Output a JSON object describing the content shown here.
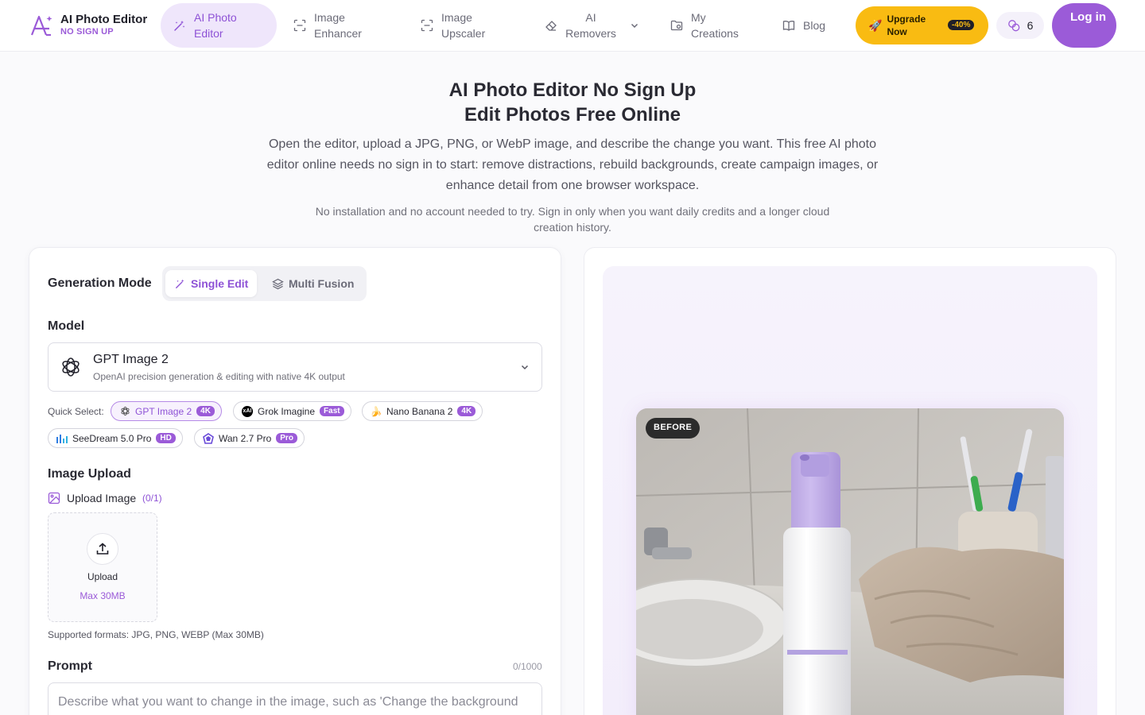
{
  "brand": {
    "name": "AI Photo Editor",
    "sub": "NO SIGN UP"
  },
  "nav": [
    {
      "label": "AI Photo Editor",
      "icon": "magic-wand-icon",
      "active": true
    },
    {
      "label": "Image Enhancer",
      "icon": "scan-icon"
    },
    {
      "label": "Image Upscaler",
      "icon": "scan-icon"
    },
    {
      "label": "AI Removers",
      "icon": "eraser-icon",
      "has_dropdown": true
    },
    {
      "label": "My Creations",
      "icon": "folder-icon"
    },
    {
      "label": "Blog",
      "icon": "book-icon"
    }
  ],
  "upgrade": {
    "label": "Upgrade Now",
    "discount": "-40%",
    "icon": "rocket-icon"
  },
  "credits": {
    "count": "6",
    "icon": "coins-icon"
  },
  "login": {
    "label": "Log in"
  },
  "hero": {
    "title_line1": "AI Photo Editor No Sign Up",
    "title_line2": "Edit Photos Free Online",
    "description": "Open the editor, upload a JPG, PNG, or WebP image, and describe the change you want. This free AI photo editor online needs no sign in to start: remove distractions, rebuild backgrounds, create campaign images, or enhance detail from one browser workspace.",
    "note": "No installation and no account needed to try. Sign in only when you want daily credits and a longer cloud creation history."
  },
  "generation": {
    "label": "Generation Mode",
    "modes": [
      {
        "label": "Single Edit",
        "selected": true
      },
      {
        "label": "Multi Fusion",
        "selected": false
      }
    ]
  },
  "model": {
    "label": "Model",
    "selected_name": "GPT Image 2",
    "selected_desc": "OpenAI precision generation & editing with native 4K output",
    "quick_select_label": "Quick Select:",
    "quick": [
      {
        "name": "GPT Image 2",
        "badge": "4K",
        "selected": true,
        "icon": "openai-icon"
      },
      {
        "name": "Grok Imagine",
        "badge": "Fast",
        "icon": "xai-icon"
      },
      {
        "name": "Nano Banana 2",
        "badge": "4K",
        "icon": "banana-icon"
      },
      {
        "name": "SeeDream 5.0 Pro",
        "badge": "HD",
        "icon": "bars-icon"
      },
      {
        "name": "Wan 2.7 Pro",
        "badge": "Pro",
        "icon": "wan-icon"
      }
    ]
  },
  "upload": {
    "label": "Image Upload",
    "sub_label": "Upload Image",
    "count": "(0/1)",
    "button": "Upload",
    "max": "Max 30MB",
    "formats": "Supported formats: JPG, PNG, WEBP (Max 30MB)"
  },
  "prompt": {
    "label": "Prompt",
    "count": "0/1000",
    "placeholder": "Describe what you want to change in the image, such as 'Change the background"
  },
  "preview": {
    "badge": "BEFORE"
  },
  "colors": {
    "accent": "#9b5bd8",
    "upgrade": "#f9bb12"
  }
}
